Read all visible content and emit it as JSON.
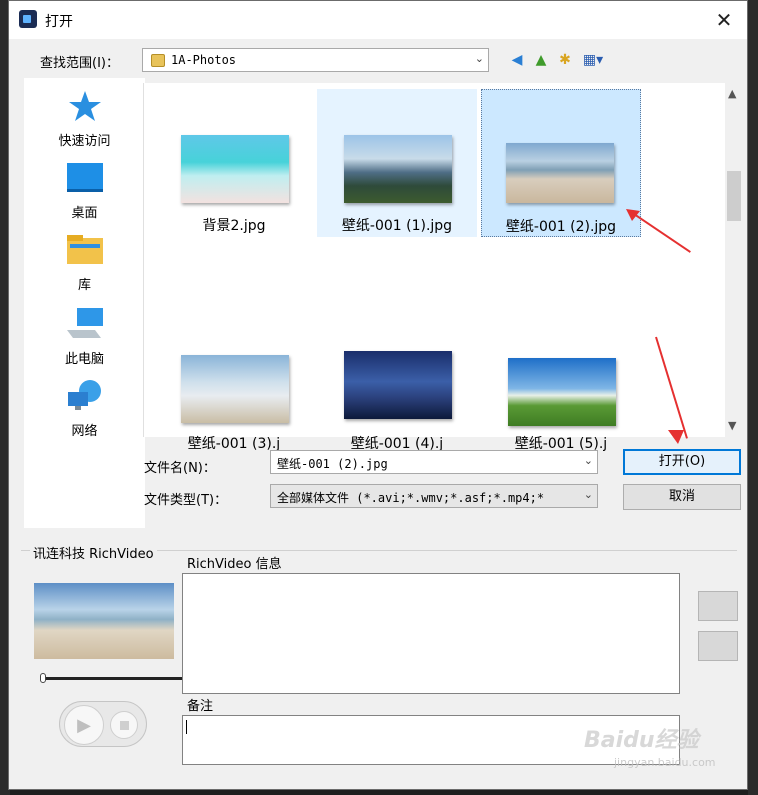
{
  "window": {
    "title": "打开",
    "close_glyph": "✕"
  },
  "lookin": {
    "label": "查找范围(I)：",
    "value": "1A-Photos"
  },
  "places": [
    {
      "name": "quick-access",
      "label": "快速访问"
    },
    {
      "name": "desktop",
      "label": "桌面"
    },
    {
      "name": "libraries",
      "label": "库"
    },
    {
      "name": "this-pc",
      "label": "此电脑"
    },
    {
      "name": "network",
      "label": "网络"
    }
  ],
  "files": [
    {
      "name": "背景2.jpg",
      "state": "normal"
    },
    {
      "name": "壁纸-001 (1).jpg",
      "state": "hover"
    },
    {
      "name": "壁纸-001 (2).jpg",
      "state": "selected"
    },
    {
      "name": "壁纸-001 (3).j",
      "state": "normal"
    },
    {
      "name": "壁纸-001 (4).j",
      "state": "normal"
    },
    {
      "name": "壁纸-001 (5).j",
      "state": "normal"
    }
  ],
  "filename": {
    "label": "文件名(N)：",
    "value": "壁纸-001 (2).jpg"
  },
  "filetype": {
    "label": "文件类型(T)：",
    "value": "全部媒体文件 (*.avi;*.wmv;*.asf;*.mp4;*"
  },
  "buttons": {
    "open": "打开(O)",
    "cancel": "取消"
  },
  "richvideo": {
    "group_label": "讯连科技 RichVideo",
    "info_label": "RichVideo 信息",
    "notes_label": "备注"
  },
  "watermark": {
    "main": "Baidu经验",
    "sub": "jingyan.baidu.com"
  },
  "colors": {
    "selection": "#cce8ff",
    "hover": "#e5f3ff",
    "accent": "#0078d7",
    "annotation_arrow": "#e53030"
  }
}
